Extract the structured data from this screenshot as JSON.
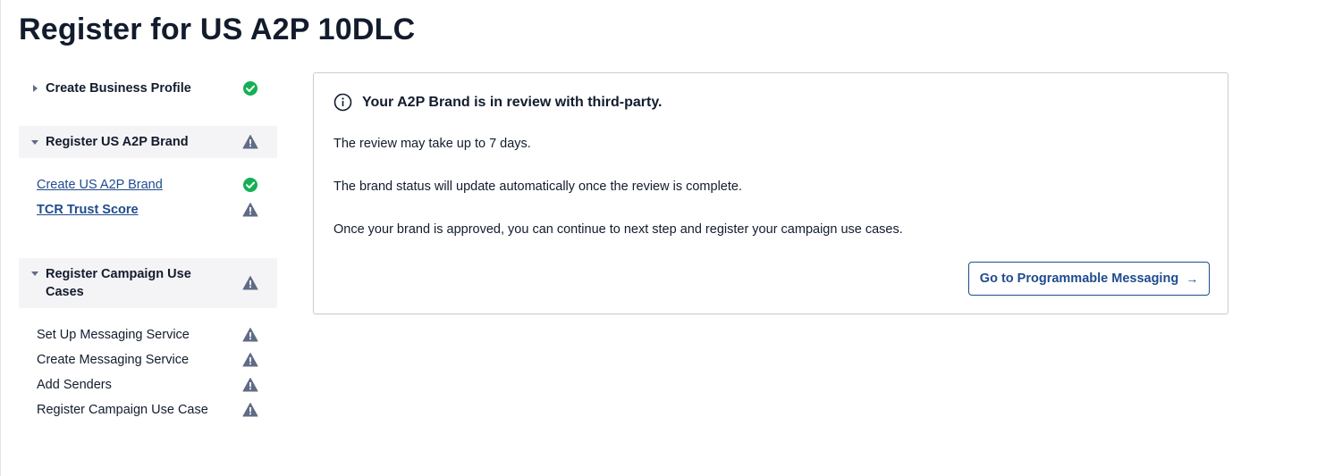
{
  "page": {
    "title": "Register for US A2P 10DLC"
  },
  "sidebar": {
    "sections": [
      {
        "label": "Create Business Profile",
        "status": "complete",
        "expanded": false
      },
      {
        "label": "Register US A2P Brand",
        "status": "warning",
        "expanded": true,
        "steps": [
          {
            "label": "Create US A2P Brand",
            "status": "complete",
            "link": true
          },
          {
            "label": "TCR Trust Score",
            "status": "warning",
            "link": true,
            "current": true
          }
        ]
      },
      {
        "label": "Register Campaign Use Cases",
        "status": "warning",
        "expanded": true,
        "steps": [
          {
            "label": "Set Up Messaging Service",
            "status": "warning"
          },
          {
            "label": "Create Messaging Service",
            "status": "warning"
          },
          {
            "label": "Add Senders",
            "status": "warning"
          },
          {
            "label": "Register Campaign Use Case",
            "status": "warning"
          }
        ]
      }
    ]
  },
  "card": {
    "heading": "Your A2P Brand is in review with third-party.",
    "paragraphs": [
      "The review may take up to 7 days.",
      "The brand status will update automatically once the review is complete.",
      "Once your brand is approved, you can continue to next step and register your campaign use cases."
    ],
    "button_label": "Go to Programmable Messaging",
    "button_arrow": "→"
  },
  "colors": {
    "success": "#14b053",
    "warning": "#606b85",
    "link": "#1f4b8f",
    "text": "#121c2d",
    "section_bg": "#f4f4f6",
    "card_border": "#cacdd8"
  },
  "icons": {
    "complete": "check-circle-icon",
    "warning": "warning-triangle-icon",
    "info": "info-icon",
    "collapsed": "caret-right-icon",
    "expanded": "caret-down-icon",
    "arrow": "arrow-right-icon"
  }
}
